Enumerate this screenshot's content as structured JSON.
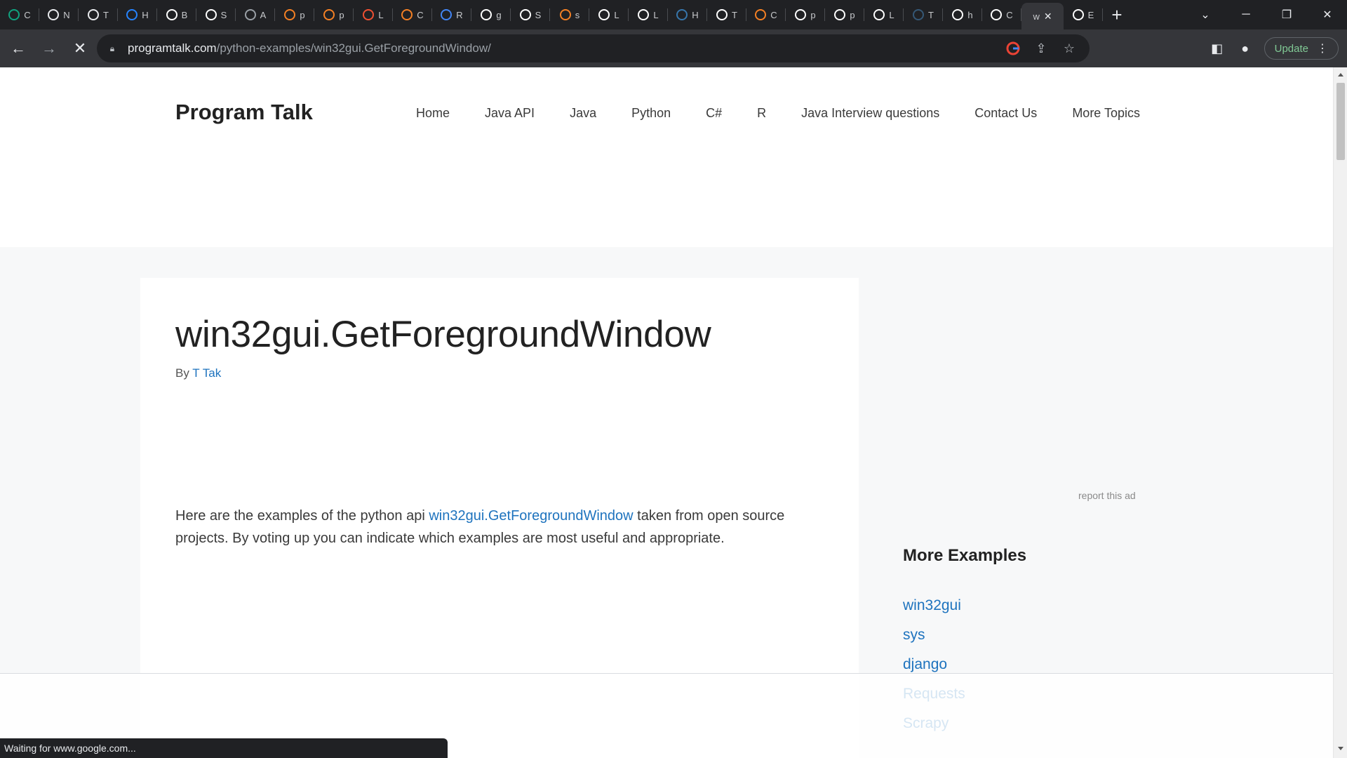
{
  "browser": {
    "tabs": [
      {
        "icon": "chatgpt-icon",
        "letter": "C",
        "color": "#10a37f"
      },
      {
        "icon": "cloud-icon",
        "letter": "N",
        "color": "#e8eaed"
      },
      {
        "icon": "cloud-icon",
        "letter": "T",
        "color": "#e8eaed"
      },
      {
        "icon": "confluence-icon",
        "letter": "H",
        "color": "#2684ff"
      },
      {
        "icon": "mail-icon",
        "letter": "B",
        "color": "#ffffff"
      },
      {
        "icon": "google-icon",
        "letter": "S",
        "color": "#ffffff"
      },
      {
        "icon": "globe-icon",
        "letter": "A",
        "color": "#9aa0a6"
      },
      {
        "icon": "stackoverflow-icon",
        "letter": "p",
        "color": "#f48024"
      },
      {
        "icon": "stackoverflow-icon",
        "letter": "p",
        "color": "#f48024"
      },
      {
        "icon": "git-icon",
        "letter": "L",
        "color": "#f05032"
      },
      {
        "icon": "stackoverflow-icon",
        "letter": "C",
        "color": "#f48024"
      },
      {
        "icon": "people-icon",
        "letter": "R",
        "color": "#4285f4"
      },
      {
        "icon": "google-icon",
        "letter": "g",
        "color": "#ffffff"
      },
      {
        "icon": "google-icon",
        "letter": "S",
        "color": "#ffffff"
      },
      {
        "icon": "stackoverflow-icon",
        "letter": "s",
        "color": "#f48024"
      },
      {
        "icon": "book-icon",
        "letter": "L",
        "color": "#ffffff"
      },
      {
        "icon": "b-icon",
        "letter": "L",
        "color": "#ffffff"
      },
      {
        "icon": "python-icon",
        "letter": "H",
        "color": "#3776ab"
      },
      {
        "icon": "medium-icon",
        "letter": "T",
        "color": "#ffffff"
      },
      {
        "icon": "stackoverflow-icon",
        "letter": "C",
        "color": "#f48024"
      },
      {
        "icon": "github-icon",
        "letter": "p",
        "color": "#ffffff"
      },
      {
        "icon": "github-icon",
        "letter": "p",
        "color": "#ffffff"
      },
      {
        "icon": "book-icon",
        "letter": "L",
        "color": "#ffffff"
      },
      {
        "icon": "tds-icon",
        "letter": "T",
        "color": "#355876"
      },
      {
        "icon": "google-icon",
        "letter": "h",
        "color": "#ffffff"
      },
      {
        "icon": "github-icon",
        "letter": "C",
        "color": "#ffffff"
      }
    ],
    "active_tab": {
      "letter": "w"
    },
    "last_tab": {
      "icon": "cb-icon",
      "letter": "E",
      "color": "#ffffff"
    },
    "url_host": "programtalk.com",
    "url_path": "/python-examples/win32gui.GetForegroundWindow/",
    "update_label": "Update",
    "status_text": "Waiting for www.google.com..."
  },
  "header": {
    "site_title": "Program Talk",
    "nav": [
      "Home",
      "Java API",
      "Java",
      "Python",
      "C#",
      "R",
      "Java Interview questions",
      "Contact Us",
      "More Topics"
    ]
  },
  "article": {
    "title": "win32gui.GetForegroundWindow",
    "by_label": "By",
    "author": "T Tak",
    "intro_before": "Here are the examples of the python api ",
    "intro_link": "win32gui.GetForegroundWindow",
    "intro_after": " taken from open source projects. By voting up you can indicate which examples are most useful and appropriate."
  },
  "sidebar": {
    "report_ad": "report this ad",
    "widget_title": "More Examples",
    "items": [
      "win32gui",
      "sys",
      "django",
      "Requests",
      "Scrapy"
    ]
  }
}
